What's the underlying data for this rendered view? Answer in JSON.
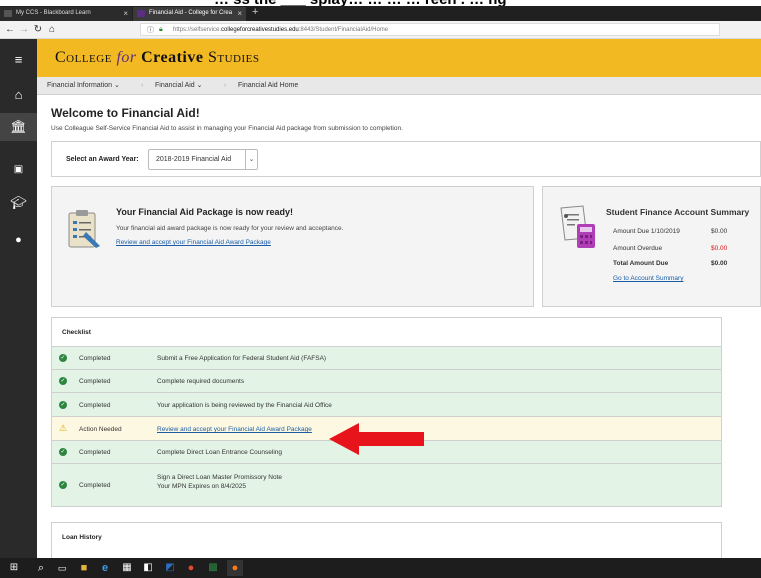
{
  "page_heading": "… ss the ___ splay… … … … reen . … ng",
  "browser": {
    "tabs": [
      {
        "title": "My CCS - Blackboard Learn"
      },
      {
        "title": "Financial Aid - College for Crea"
      }
    ],
    "url_prefix": "https://selfservice.",
    "url_domain": "collegeforcreativestudies.edu",
    "url_rest": ":8443/Student/FinancialAid/Home"
  },
  "header": {
    "logo_college": "College",
    "logo_for": "for",
    "logo_creative": "Creative",
    "logo_studies": "Studies"
  },
  "breadcrumbs": [
    {
      "label": "Financial Information"
    },
    {
      "label": "Financial Aid"
    },
    {
      "label": "Financial Aid Home"
    }
  ],
  "main": {
    "title": "Welcome to Financial Aid!",
    "subtitle": "Use Colleague Self-Service Financial Aid to assist in managing your Financial Aid package from submission to completion.",
    "award_year": {
      "label": "Select an Award Year:",
      "selected": "2018-2019 Financial Aid"
    }
  },
  "package_card": {
    "title": "Your Financial Aid Package is now ready!",
    "text": "Your financial aid award package is now ready for your review and acceptance.",
    "link": "Review and accept your Financial Aid Award Package"
  },
  "summary_card": {
    "title": "Student Finance Account Summary",
    "rows": [
      {
        "label": "Amount Due 1/10/2019",
        "value": "$0.00"
      },
      {
        "label": "Amount Overdue",
        "value": "$0.00"
      },
      {
        "label": "Total Amount Due",
        "value": "$0.00"
      }
    ],
    "link": "Go to Account Summary"
  },
  "checklist": {
    "title": "Checklist",
    "items": [
      {
        "status": "Completed",
        "desc": "Submit a Free Application for Federal Student Aid (FAFSA)"
      },
      {
        "status": "Completed",
        "desc": "Complete required documents"
      },
      {
        "status": "Completed",
        "desc": "Your application is being reviewed by the Financial Aid Office"
      },
      {
        "status": "Action Needed",
        "desc": "Review and accept your Financial Aid Award Package"
      },
      {
        "status": "Completed",
        "desc": "Complete Direct Loan Entrance Counseling"
      },
      {
        "status": "Completed",
        "desc": "Sign a Direct Loan Master Promissory Note",
        "desc2": "Your MPN Expires on 8/4/2025"
      }
    ]
  },
  "loan_history": {
    "title": "Loan History"
  },
  "colors": {
    "brand_gold": "#f3b922",
    "brand_purple": "#5b2d83",
    "complete_green": "#2e8540",
    "highlight_red": "#e8141b"
  }
}
